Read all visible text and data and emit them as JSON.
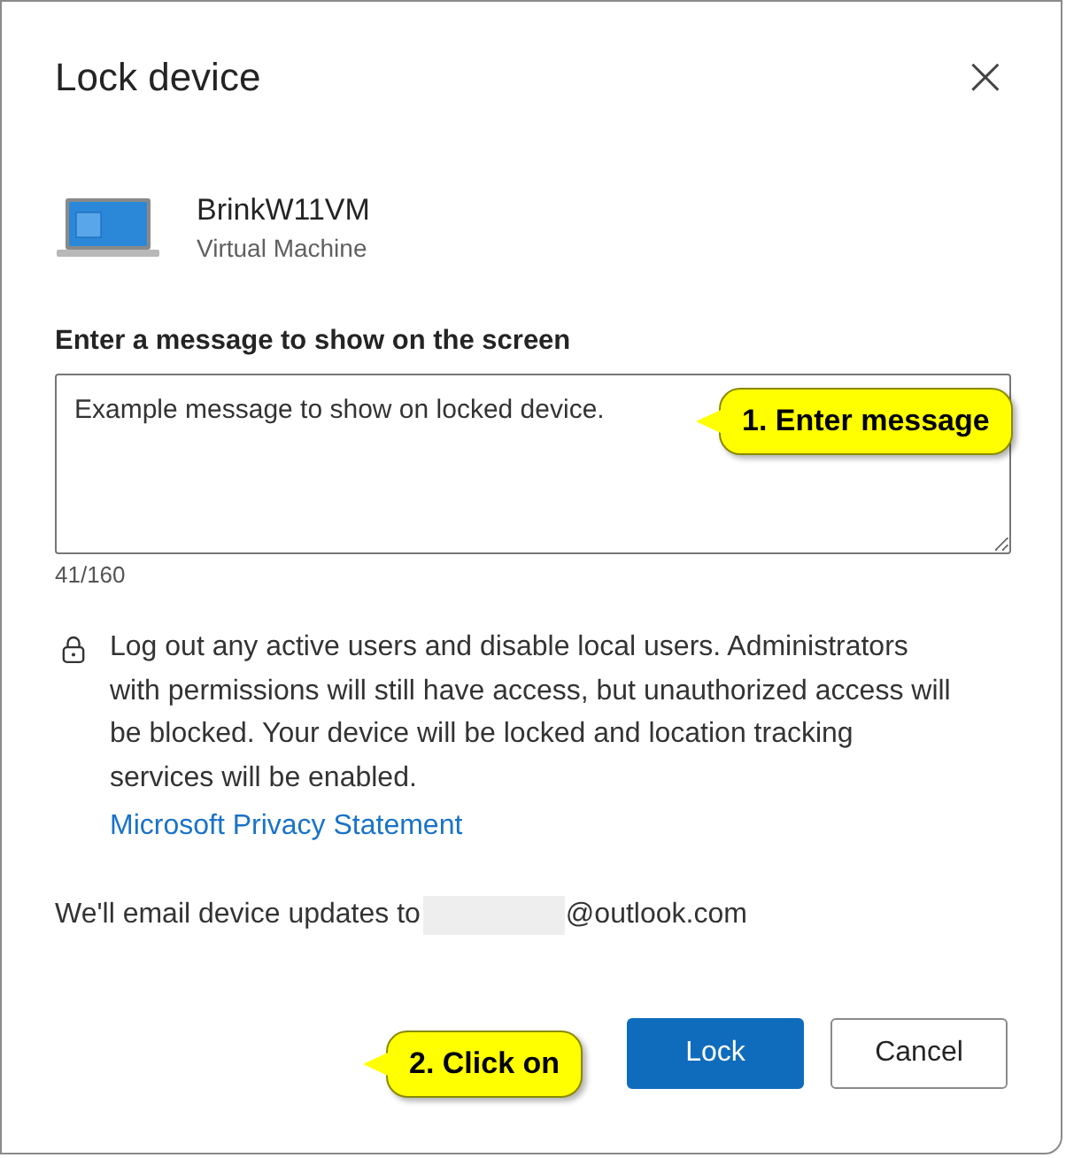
{
  "dialog": {
    "title": "Lock device",
    "close": "×"
  },
  "device": {
    "name": "BrinkW11VM",
    "type": "Virtual Machine"
  },
  "message": {
    "label": "Enter a message to show on the screen",
    "value": "Example message to show on locked device.",
    "counter": "41/160"
  },
  "notice": {
    "text": "Log out any active users and disable local users. Administrators with permissions will still have access, but unauthorized access will be blocked. Your device will be locked and location tracking services will be enabled.",
    "link": "Microsoft Privacy Statement"
  },
  "email": {
    "prefix": "We'll email device updates to",
    "redacted": true,
    "domain": "@outlook.com"
  },
  "buttons": [
    {
      "label": "Lock",
      "kind": "primary"
    },
    {
      "label": "Cancel",
      "kind": "secondary"
    }
  ],
  "callouts": [
    {
      "text": "1. Enter message"
    },
    {
      "text": "2. Click on"
    }
  ]
}
